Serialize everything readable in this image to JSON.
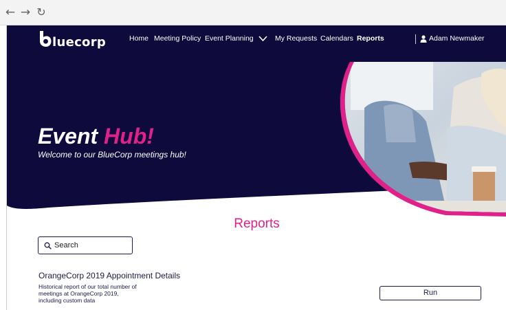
{
  "browser": {
    "back_icon": "arrow-left-icon",
    "forward_icon": "arrow-right-icon",
    "reload_icon": "reload-icon"
  },
  "header": {
    "logo_text": "luecorp",
    "nav": [
      {
        "label": "Home"
      },
      {
        "label": "Meeting Policy"
      },
      {
        "label": "Event Planning",
        "has_dropdown": true
      },
      {
        "label": "My Requests"
      },
      {
        "label": "Calendars"
      },
      {
        "label": "Reports",
        "active": true
      }
    ],
    "user_name": "Adam Newmaker"
  },
  "hero": {
    "title_part1": "Event",
    "title_part2": "Hub!",
    "subtitle": "Welcome to our BlueCorp meetings hub!"
  },
  "main": {
    "section_title": "Reports",
    "search": {
      "placeholder": "Search"
    },
    "reports": [
      {
        "title": "OrangeCorp 2019 Appointment Details",
        "description_lines": [
          "Historical report of our total number of",
          "meetings at OrangeCorp 2019,",
          "including custom data"
        ],
        "action_label": "Run"
      }
    ]
  },
  "colors": {
    "navy": "#0e0a3c",
    "accent_pink": "#e0218a",
    "text_dark": "#1b1a4a"
  }
}
